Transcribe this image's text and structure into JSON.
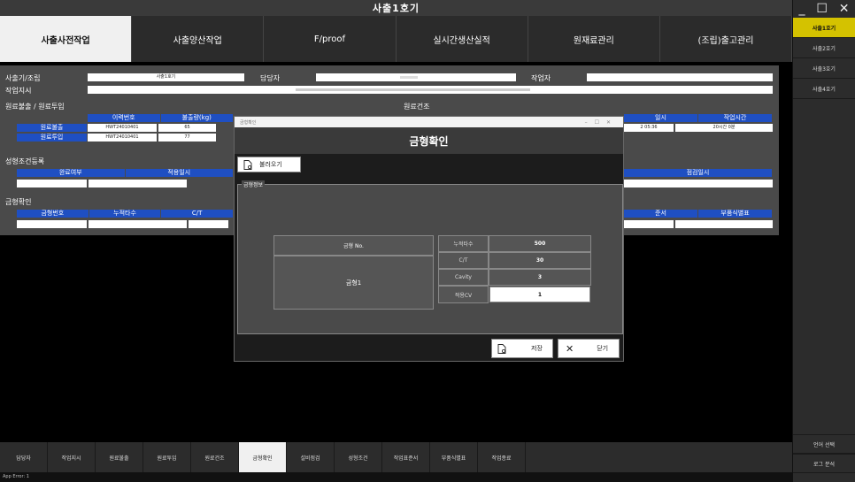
{
  "window": {
    "title": "사출1호기",
    "controls": [
      "_",
      "☐",
      "✕"
    ]
  },
  "side_menu": {
    "machines": [
      "사출1호기",
      "사출2호기",
      "사출3호기",
      "사출4호기"
    ],
    "active_index": 0,
    "bottom": [
      "언어 선택",
      "로그 분석"
    ],
    "accent": "#d4c200"
  },
  "top_tabs": {
    "items": [
      "사출사전작업",
      "사출양산작업",
      "F/proof",
      "실시간생산실적",
      "원재료관리",
      "(조립)출고관리"
    ],
    "active_index": 0
  },
  "main": {
    "machine_label": "사출기/조립",
    "machine_value": "사출1호기",
    "manager_label": "담당자",
    "worker_label": "작업자",
    "work_order_label": "작업지시",
    "material_section": "원료불출 / 원료투입",
    "material_headers": [
      "이력번호",
      "불출량(kg)"
    ],
    "material_rows": [
      {
        "label": "원료불출",
        "lot": "HWT24010401",
        "qty": "65"
      },
      {
        "label": "원료투입",
        "lot": "HWT24010401",
        "qty": "77"
      }
    ],
    "dry_section": "원료건조",
    "dry_headers": [
      "일시",
      "작업시간"
    ],
    "dry_row": {
      "time": "2 05:36",
      "duration": "20시간 0분"
    },
    "cond_section": "성형조건등록",
    "cond_headers": [
      "완료여부",
      "적용일시"
    ],
    "check_header": "점검일시",
    "mold_section": "금형확인",
    "mold_headers": [
      "금형번호",
      "누적타수",
      "C/T"
    ],
    "mold_right_headers": [
      "준서",
      "부품식별표"
    ]
  },
  "dialog": {
    "window_caption": "금형확인",
    "title": "금형확인",
    "load_button": "불러오기",
    "group_label": "금형정보",
    "mold_no_header": "금형 No.",
    "mold_no_value": "금형1",
    "fields": [
      {
        "label": "누적타수",
        "value": "500"
      },
      {
        "label": "C/T",
        "value": "30"
      },
      {
        "label": "Cavity",
        "value": "3"
      },
      {
        "label": "적용CV",
        "value": "1"
      }
    ],
    "save_button": "저장",
    "close_button": "닫기",
    "save_icon": "document-icon",
    "close_icon": "x-icon"
  },
  "bottom_tabs": {
    "items": [
      "담당자",
      "작업지시",
      "원료불출",
      "원료투입",
      "원료건조",
      "금형확인",
      "설비점검",
      "성형조건",
      "작업표준서",
      "부품식별표",
      "작업종료"
    ],
    "active_index": 5
  },
  "status": {
    "text": "App Error:   1"
  }
}
